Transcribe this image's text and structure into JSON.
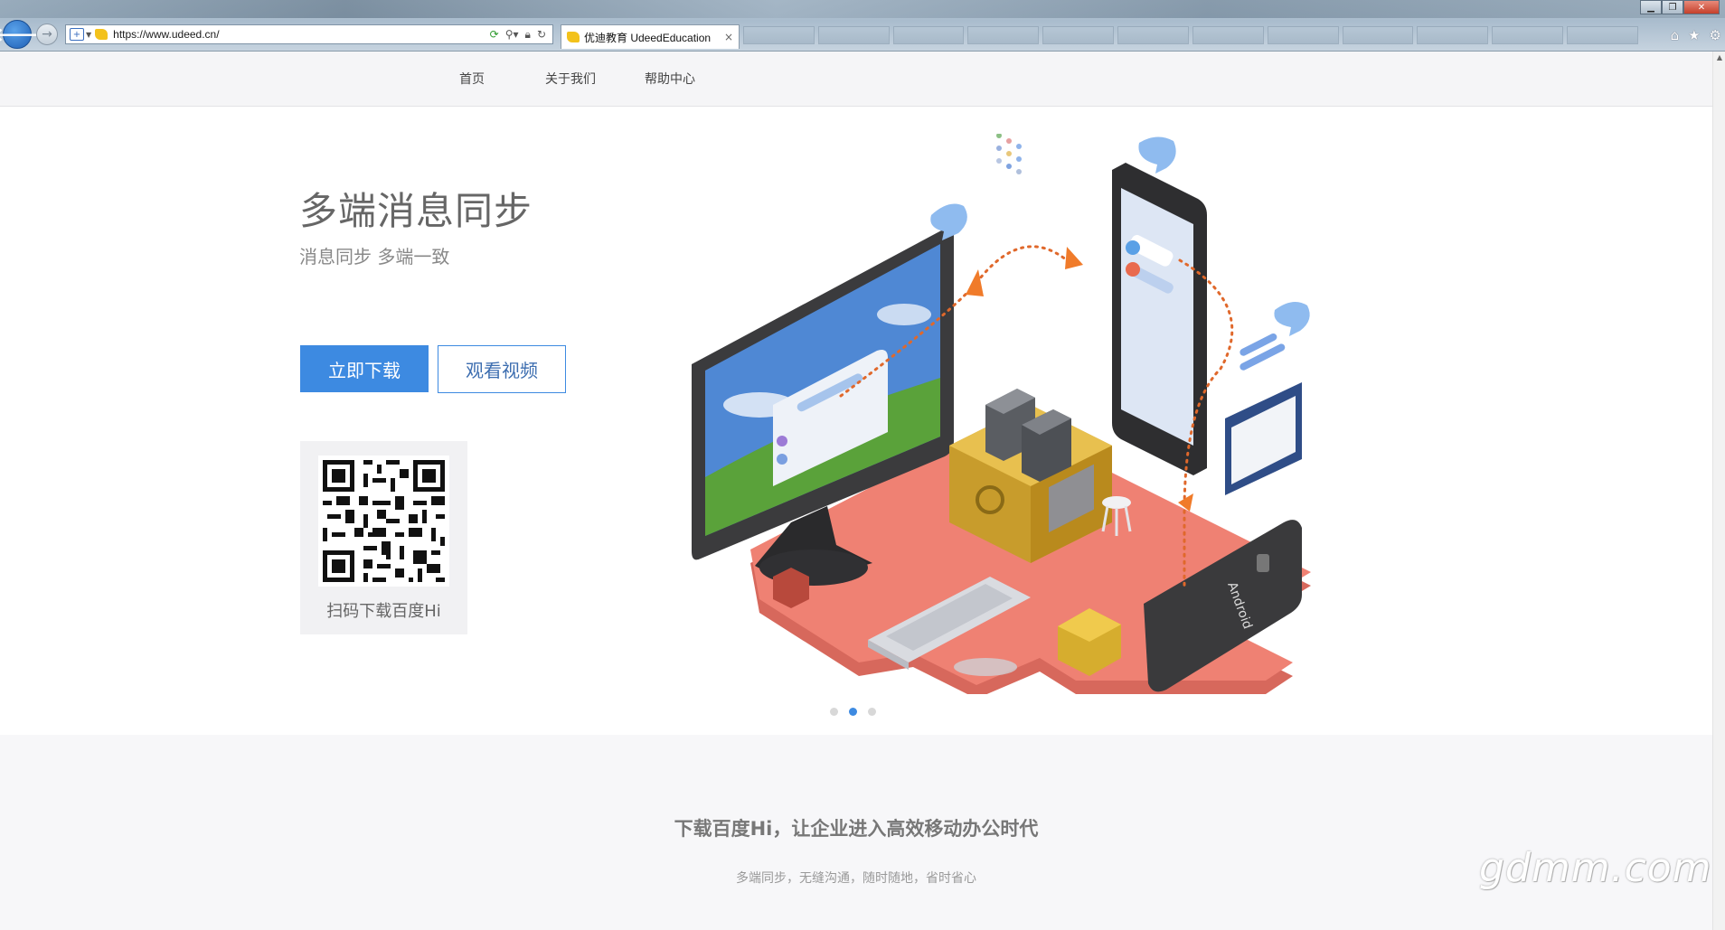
{
  "browser": {
    "url": "https://www.udeed.cn/",
    "tab_title": "优迪教育 UdeedEducation",
    "tab_close": "×",
    "back_glyph": "🡐",
    "forward_glyph": "→",
    "icons": [
      "home-icon",
      "star-icon",
      "gear-icon"
    ]
  },
  "nav": {
    "items": [
      "首页",
      "关于我们",
      "帮助中心"
    ]
  },
  "hero": {
    "title": "多端消息同步",
    "subtitle": "消息同步 多端一致",
    "download_button": "立即下载",
    "video_button": "观看视频",
    "qr_caption": "扫码下载百度Hi",
    "carousel_active_index": 1,
    "carousel_count": 3,
    "device_label": "Android"
  },
  "bottom": {
    "title": "下载百度Hi，让企业进入高效移动办公时代",
    "subtitle": "多端同步，无缝沟通，随时随地，省时省心"
  },
  "watermark": "gdmm.com",
  "colors": {
    "accent": "#3d8ae1",
    "platform": "#ec7a6c",
    "safe": "#e0b94a"
  }
}
